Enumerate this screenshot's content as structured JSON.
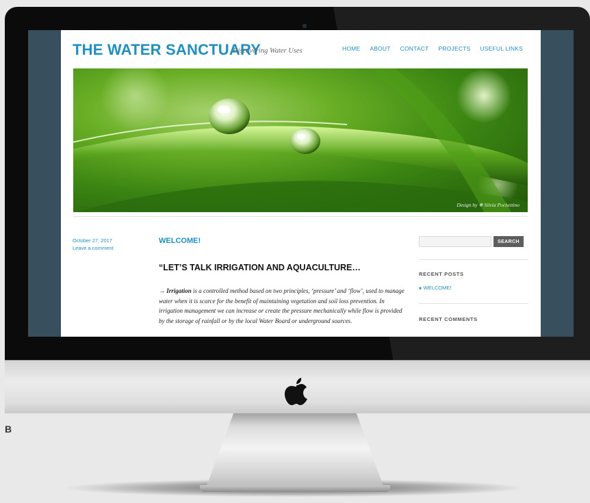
{
  "site": {
    "title": "THE WATER SANCTUARY",
    "description": "Discovering Water Uses"
  },
  "nav": {
    "items": [
      "HOME",
      "ABOUT",
      "CONTACT",
      "PROJECTS",
      "USEFUL LINKS"
    ]
  },
  "hero": {
    "credit": "Design by ❄ Silvia Pochettino"
  },
  "post": {
    "date": "October 27, 2017",
    "comment_link": "Leave a comment",
    "title": "WELCOME!",
    "heading": "“LET’S TALK IRRIGATION AND AQUACULTURE…",
    "arrow": "→",
    "term": "Irrigation",
    "body": " is a controlled method based on two principles, ‘pressure’ and ‘flow’, used to manage water when it is scarce for the benefit of maintaining vegetation and soil loss prevention. In irrigation management we can increase or create the pressure mechanically while flow is provided by the storage of rainfall or by the local Water Board or underground sources."
  },
  "sidebar": {
    "search_button": "SEARCH",
    "recent_posts_heading": "RECENT POSTS",
    "recent_posts": [
      "WELCOME!"
    ],
    "recent_comments_heading": "RECENT COMMENTS"
  },
  "figure_label": "B",
  "colors": {
    "accent": "#1f8fc2",
    "screen_bezel": "#38505e",
    "search_button": "#5d5d5d"
  },
  "icons": [
    "apple-logo-icon",
    "camera-icon"
  ]
}
